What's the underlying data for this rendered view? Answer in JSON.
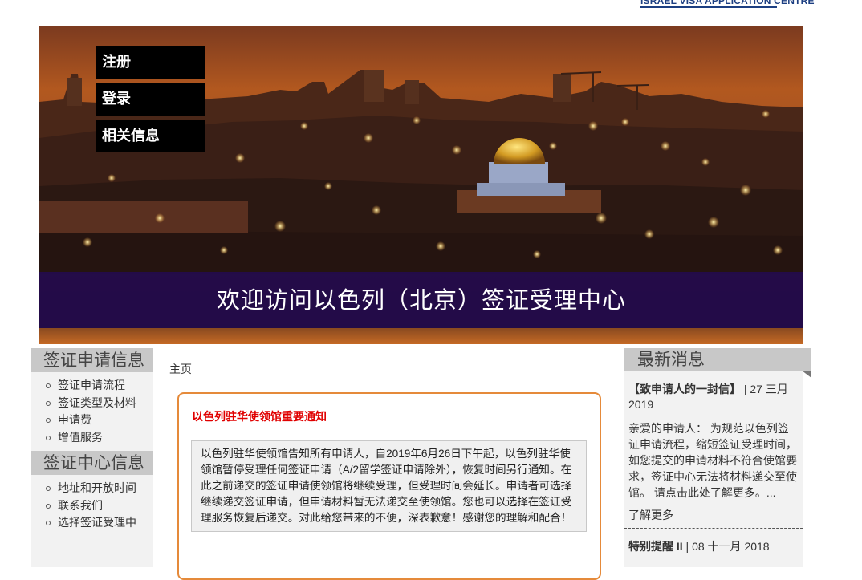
{
  "header": {
    "logo_text": "ISRAEL VISA APPLICATION CENTRE"
  },
  "hero": {
    "menu": [
      "注册",
      "登录",
      "相关信息"
    ],
    "caption": "欢迎访问以色列（北京）签证受理中心"
  },
  "sidebar": {
    "sections": [
      {
        "title": "签证申请信息",
        "items": [
          "签证申请流程",
          "签证类型及材料",
          "申请费",
          "增值服务"
        ]
      },
      {
        "title": "签证中心信息",
        "items": [
          "地址和开放时间",
          "联系我们",
          "选择签证受理中"
        ]
      }
    ]
  },
  "main": {
    "breadcrumb": "主页",
    "notice_title": "以色列驻华使领馆重要通知",
    "notice_body": "以色列驻华使领馆告知所有申请人，自2019年6月26日下午起，以色列驻华使领馆暂停受理任何签证申请（A/2留学签证申请除外），恢复时间另行通知。在此之前递交的签证申请使领馆将继续受理，但受理时间会延长。申请者可选择继续递交签证申请，但申请材料暂无法递交至使领馆。您也可以选择在签证受理服务恢复后递交。对此给您带来的不便，深表歉意！感谢您的理解和配合！"
  },
  "news": {
    "title": "最新消息",
    "items": [
      {
        "title": "【致申请人的一封信】",
        "date": " | 27 三月 2019",
        "body": "亲爱的申请人： 为规范以色列签证申请流程，缩短签证受理时间，如您提交的申请材料不符合使馆要求，签证中心无法将材料递交至使馆。 请点击此处了解更多。...",
        "more": "了解更多"
      },
      {
        "title": "特别提醒 II",
        "date": " | 08 十一月 2018"
      }
    ]
  },
  "colors": {
    "menu_bg": "#000000",
    "caption_bg": "#230a50",
    "notice_border": "#e58a3a",
    "notice_title": "#e00000"
  }
}
